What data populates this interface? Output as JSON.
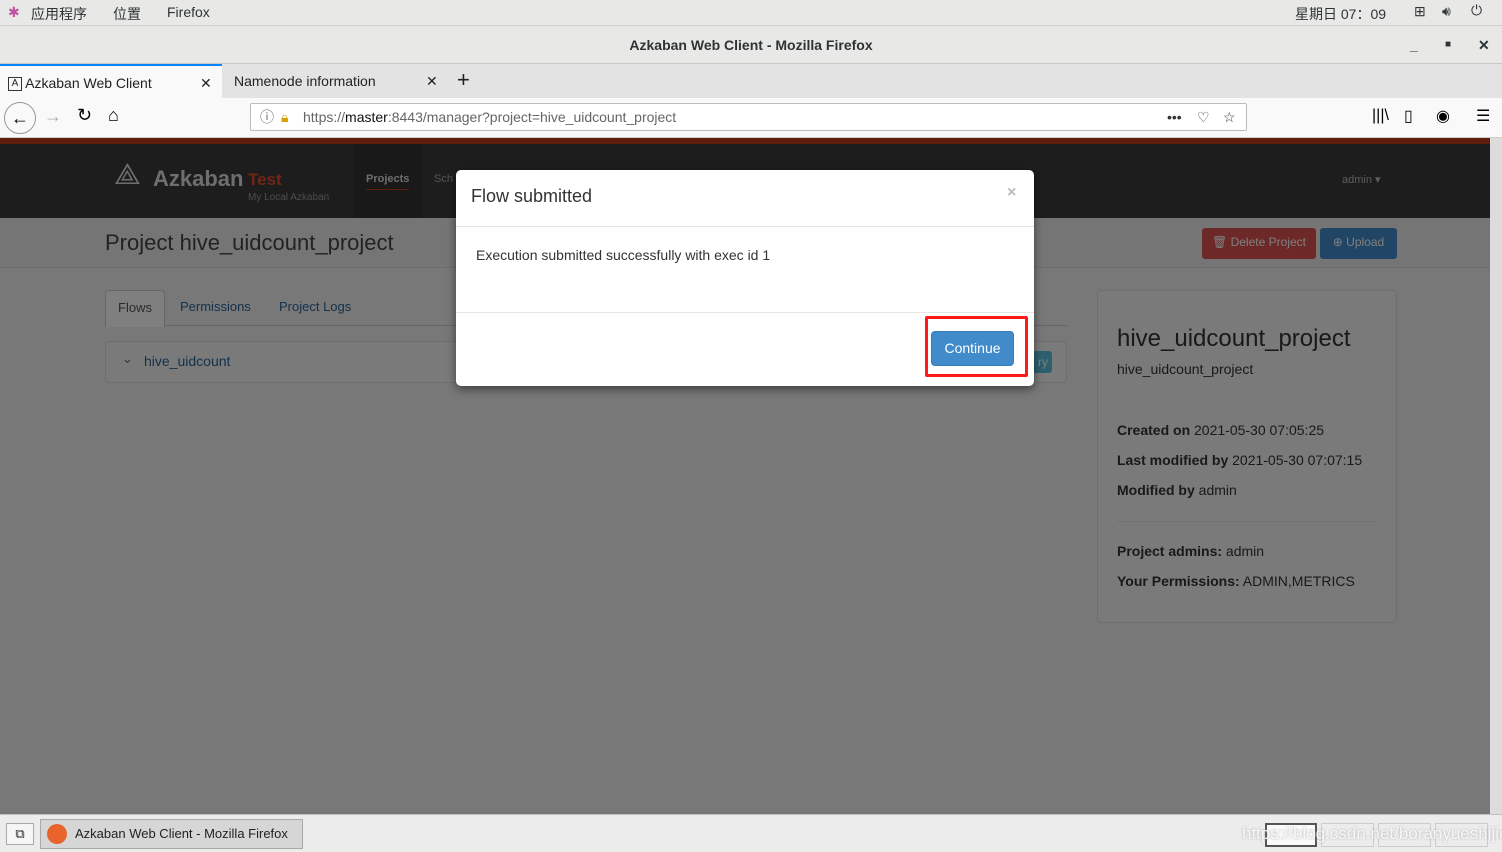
{
  "system_bar": {
    "apps": "应用程序",
    "places": "位置",
    "app": "Firefox",
    "clock": "星期日 07：09"
  },
  "window": {
    "title": "Azkaban Web Client - Mozilla Firefox"
  },
  "tabs": [
    {
      "label": "Azkaban Web Client",
      "active": true
    },
    {
      "label": "Namenode information",
      "active": false
    }
  ],
  "url": {
    "prefix": "https://",
    "host": "master",
    "rest": ":8443/manager?project=hive_uidcount_project"
  },
  "azkaban": {
    "brand": "Azkaban",
    "env": "Test",
    "subtitle": "My Local Azkaban",
    "nav": [
      "Projects",
      "Sch"
    ],
    "user": "admin",
    "project_title": "Project hive_uidcount_project",
    "delete_label": "Delete Project",
    "upload_label": "Upload",
    "subtabs": [
      "Flows",
      "Permissions",
      "Project Logs"
    ],
    "flow": "hive_uidcount",
    "flow_btn_partial": "ry",
    "info": {
      "name": "hive_uidcount_project",
      "description": "hive_uidcount_project",
      "created_label": "Created on",
      "created": "2021-05-30 07:05:25",
      "modified_label": "Last modified by",
      "modified": "2021-05-30 07:07:15",
      "modified_by_label": "Modified by",
      "modified_by": "admin",
      "admins_label": "Project admins:",
      "admins": "admin",
      "perms_label": "Your Permissions:",
      "perms": "ADMIN,METRICS"
    }
  },
  "modal": {
    "title": "Flow submitted",
    "close": "×",
    "message": "Execution submitted successfully with exec id 1",
    "continue_label": "Continue"
  },
  "taskbar": {
    "window_label": "Azkaban Web Client - Mozilla Firefox",
    "watermark": "https://blog.csdn.net/boranyueshijie"
  },
  "colors": {
    "accent": "#428bca",
    "danger": "#d9534f",
    "highlight": "#ff1a1a",
    "header": "#2b2b2b",
    "brand_red": "#c0391b"
  }
}
